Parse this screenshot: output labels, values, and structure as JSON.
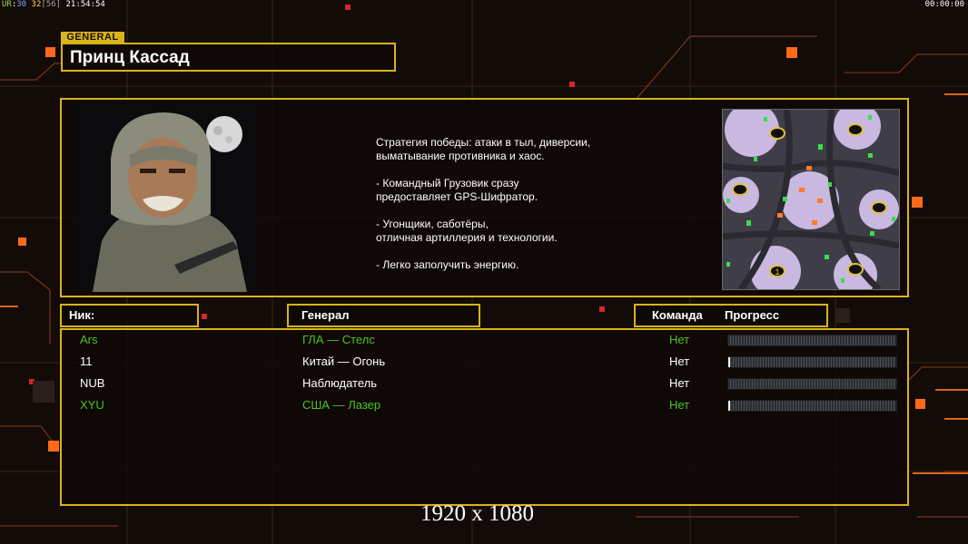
{
  "hud": {
    "fps_a": "UR",
    "fps_b": "30",
    "fps_c": "32",
    "fps_d": "[56]",
    "clock": "21:54:54",
    "timer": "00:00:00"
  },
  "general": {
    "tag": "GENERAL",
    "name": "Принц Кассад"
  },
  "description": "Стратегия победы: атаки в тыл, диверсии,\n выматывание противника и хаос.\n\n- Командный Грузовик сразу\nпредоставляет GPS-Шифратор.\n\n- Угонщики, саботёры,\nотличная артиллерия и технологии.\n\n- Легко заполучить энергию.",
  "minimap": {
    "marker": "1"
  },
  "headers": {
    "nick": "Ник:",
    "general": "Генерал",
    "team": "Команда",
    "progress": "Прогресс"
  },
  "players": [
    {
      "nick": "Ars",
      "general": "ГЛА — Стелс",
      "team": "Нет",
      "color": "green",
      "progress": 0.0
    },
    {
      "nick": "11",
      "general": "Китай — Огонь",
      "team": "Нет",
      "color": "white",
      "progress": 0.01
    },
    {
      "nick": "NUB",
      "general": "Наблюдатель",
      "team": "Нет",
      "color": "white",
      "progress": 0.0
    },
    {
      "nick": "XYU",
      "general": "США — Лазер",
      "team": "Нет",
      "color": "green",
      "progress": 0.01
    }
  ],
  "resolution": "1920 x 1080",
  "colors": {
    "frame": "#d9b418",
    "accent_orange": "#ff6a1a",
    "player_green": "#4bc422"
  }
}
